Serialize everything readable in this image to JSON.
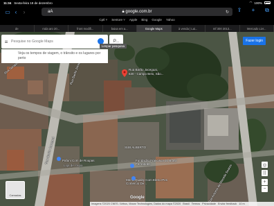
{
  "status": {
    "time": "11:34",
    "date": "Sexta-feira 18 de dezembro",
    "battery": "100%"
  },
  "toolbar": {
    "aa": "aA",
    "domain": "google.com.br",
    "reload": "↻"
  },
  "favorites": [
    "Cptl ˅",
    "Sentore ˅",
    "Apple",
    "Bing",
    "Google",
    "Yahoo"
  ],
  "tabs": [
    {
      "label": "de",
      "active": false
    },
    {
      "label": "roda aro 20...",
      "active": false
    },
    {
      "label": "front modifi...",
      "active": false
    },
    {
      "label": "baixa em a...",
      "active": false
    },
    {
      "label": "Google Maps",
      "active": true
    },
    {
      "label": "à venda | Lai...",
      "active": false
    },
    {
      "label": "mf 300 2013...",
      "active": false
    },
    {
      "label": "Mercado Livr...",
      "active": false
    }
  ],
  "search": {
    "placeholder": "Pesquise no Google Maps",
    "chip": "P...",
    "tooltip": "Limpar pesquisa"
  },
  "travel_text": "Veja os tempos de viagem, o trânsito e os lugares por perto",
  "signin": "Fazer login",
  "place": {
    "line1": "Rua Barão Jaceguai,",
    "line2": "630 - Campo Belo, São..."
  },
  "labels": {
    "rua_jaceguai_left": "Rua Barão Jaceguai",
    "rua_jaceguai_mid": "Rua Barão Jaceguai",
    "rua_jaceguai_top": "Rua Barão Jaceguai",
    "sarapo": "Rua Sarapui",
    "pafuni": "Pafuni Com de Roupas",
    "pafuni_sub": "Loja de roupa",
    "fundacao": "Fundação Francisca do Brasil Fernandes",
    "merra": "Merra Quality Com Eletro-Pes Comercio De...",
    "sub_alberto": "SUB ALBERTO",
    "rua_amanda": "Rua Antonio de Macedo Soares"
  },
  "layers_label": "Camadas",
  "google_logo": "Google",
  "footer": [
    "Imagens ©2020 CNES / Airbus, Maxar Technologies, Dados do mapa ©2020",
    "Brasil",
    "Termos",
    "Privacidade",
    "Enviar feedback",
    "10 m"
  ]
}
